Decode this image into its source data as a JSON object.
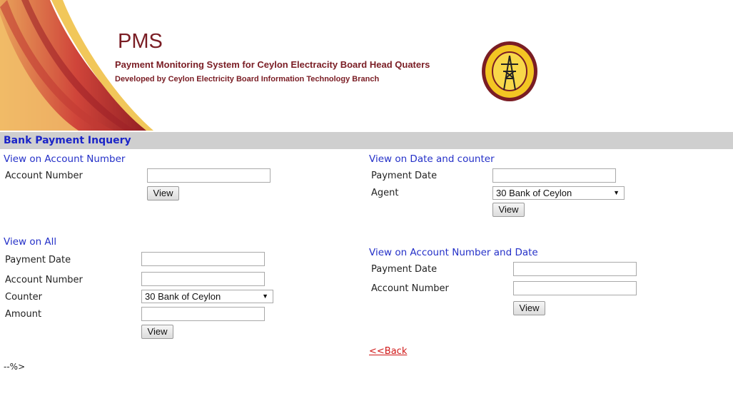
{
  "header": {
    "app_short_name": "PMS",
    "app_full_name": "Payment Monitoring System for Ceylon Electracity Board Head Quaters",
    "developer": "Developed by Ceylon Electricity Board Information Technology Branch",
    "logo_icon": "ceb-pylon-logo-icon",
    "brand_color": "#7a1d24"
  },
  "page": {
    "title": "Bank Payment Inquery",
    "title_color": "#1a24c8",
    "back_link": "<<Back",
    "trailing_text": "--%>"
  },
  "account_section": {
    "title": "View on Account Number",
    "account_label": "Account Number",
    "account_value": "",
    "view_label": "View"
  },
  "date_counter_section": {
    "title": "View on Date and counter",
    "date_label": "Payment Date",
    "date_value": "",
    "agent_label": "Agent",
    "agent_selected": "30 Bank of Ceylon",
    "view_label": "View"
  },
  "all_section": {
    "title": "View on All",
    "date_label": "Payment Date",
    "date_value": "",
    "account_label": "Account Number",
    "account_value": "",
    "counter_label": "Counter",
    "counter_selected": "30 Bank of Ceylon",
    "amount_label": "Amount",
    "amount_value": "",
    "view_label": "View"
  },
  "account_date_section": {
    "title": "View on Account Number and Date",
    "date_label": "Payment Date",
    "date_value": "",
    "account_label": "Account Number",
    "account_value": "",
    "view_label": "View"
  }
}
